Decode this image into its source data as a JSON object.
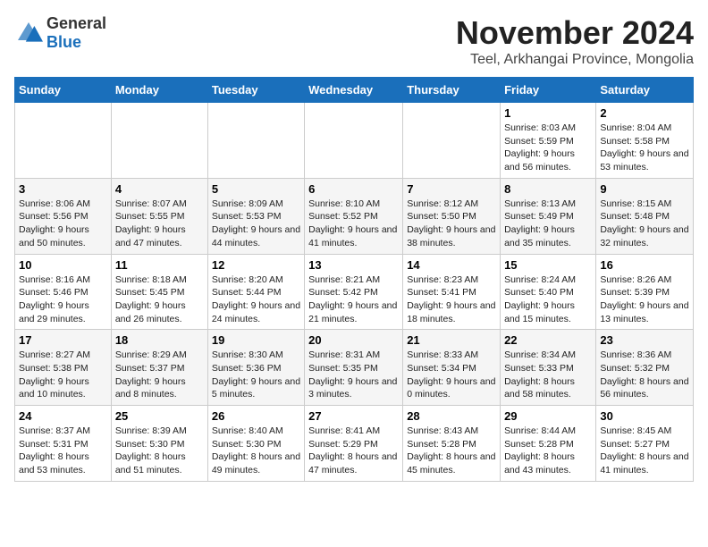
{
  "logo": {
    "general": "General",
    "blue": "Blue"
  },
  "title": {
    "month": "November 2024",
    "location": "Teel, Arkhangai Province, Mongolia"
  },
  "headers": [
    "Sunday",
    "Monday",
    "Tuesday",
    "Wednesday",
    "Thursday",
    "Friday",
    "Saturday"
  ],
  "rows": [
    [
      {
        "day": "",
        "info": ""
      },
      {
        "day": "",
        "info": ""
      },
      {
        "day": "",
        "info": ""
      },
      {
        "day": "",
        "info": ""
      },
      {
        "day": "",
        "info": ""
      },
      {
        "day": "1",
        "info": "Sunrise: 8:03 AM\nSunset: 5:59 PM\nDaylight: 9 hours and 56 minutes."
      },
      {
        "day": "2",
        "info": "Sunrise: 8:04 AM\nSunset: 5:58 PM\nDaylight: 9 hours and 53 minutes."
      }
    ],
    [
      {
        "day": "3",
        "info": "Sunrise: 8:06 AM\nSunset: 5:56 PM\nDaylight: 9 hours and 50 minutes."
      },
      {
        "day": "4",
        "info": "Sunrise: 8:07 AM\nSunset: 5:55 PM\nDaylight: 9 hours and 47 minutes."
      },
      {
        "day": "5",
        "info": "Sunrise: 8:09 AM\nSunset: 5:53 PM\nDaylight: 9 hours and 44 minutes."
      },
      {
        "day": "6",
        "info": "Sunrise: 8:10 AM\nSunset: 5:52 PM\nDaylight: 9 hours and 41 minutes."
      },
      {
        "day": "7",
        "info": "Sunrise: 8:12 AM\nSunset: 5:50 PM\nDaylight: 9 hours and 38 minutes."
      },
      {
        "day": "8",
        "info": "Sunrise: 8:13 AM\nSunset: 5:49 PM\nDaylight: 9 hours and 35 minutes."
      },
      {
        "day": "9",
        "info": "Sunrise: 8:15 AM\nSunset: 5:48 PM\nDaylight: 9 hours and 32 minutes."
      }
    ],
    [
      {
        "day": "10",
        "info": "Sunrise: 8:16 AM\nSunset: 5:46 PM\nDaylight: 9 hours and 29 minutes."
      },
      {
        "day": "11",
        "info": "Sunrise: 8:18 AM\nSunset: 5:45 PM\nDaylight: 9 hours and 26 minutes."
      },
      {
        "day": "12",
        "info": "Sunrise: 8:20 AM\nSunset: 5:44 PM\nDaylight: 9 hours and 24 minutes."
      },
      {
        "day": "13",
        "info": "Sunrise: 8:21 AM\nSunset: 5:42 PM\nDaylight: 9 hours and 21 minutes."
      },
      {
        "day": "14",
        "info": "Sunrise: 8:23 AM\nSunset: 5:41 PM\nDaylight: 9 hours and 18 minutes."
      },
      {
        "day": "15",
        "info": "Sunrise: 8:24 AM\nSunset: 5:40 PM\nDaylight: 9 hours and 15 minutes."
      },
      {
        "day": "16",
        "info": "Sunrise: 8:26 AM\nSunset: 5:39 PM\nDaylight: 9 hours and 13 minutes."
      }
    ],
    [
      {
        "day": "17",
        "info": "Sunrise: 8:27 AM\nSunset: 5:38 PM\nDaylight: 9 hours and 10 minutes."
      },
      {
        "day": "18",
        "info": "Sunrise: 8:29 AM\nSunset: 5:37 PM\nDaylight: 9 hours and 8 minutes."
      },
      {
        "day": "19",
        "info": "Sunrise: 8:30 AM\nSunset: 5:36 PM\nDaylight: 9 hours and 5 minutes."
      },
      {
        "day": "20",
        "info": "Sunrise: 8:31 AM\nSunset: 5:35 PM\nDaylight: 9 hours and 3 minutes."
      },
      {
        "day": "21",
        "info": "Sunrise: 8:33 AM\nSunset: 5:34 PM\nDaylight: 9 hours and 0 minutes."
      },
      {
        "day": "22",
        "info": "Sunrise: 8:34 AM\nSunset: 5:33 PM\nDaylight: 8 hours and 58 minutes."
      },
      {
        "day": "23",
        "info": "Sunrise: 8:36 AM\nSunset: 5:32 PM\nDaylight: 8 hours and 56 minutes."
      }
    ],
    [
      {
        "day": "24",
        "info": "Sunrise: 8:37 AM\nSunset: 5:31 PM\nDaylight: 8 hours and 53 minutes."
      },
      {
        "day": "25",
        "info": "Sunrise: 8:39 AM\nSunset: 5:30 PM\nDaylight: 8 hours and 51 minutes."
      },
      {
        "day": "26",
        "info": "Sunrise: 8:40 AM\nSunset: 5:30 PM\nDaylight: 8 hours and 49 minutes."
      },
      {
        "day": "27",
        "info": "Sunrise: 8:41 AM\nSunset: 5:29 PM\nDaylight: 8 hours and 47 minutes."
      },
      {
        "day": "28",
        "info": "Sunrise: 8:43 AM\nSunset: 5:28 PM\nDaylight: 8 hours and 45 minutes."
      },
      {
        "day": "29",
        "info": "Sunrise: 8:44 AM\nSunset: 5:28 PM\nDaylight: 8 hours and 43 minutes."
      },
      {
        "day": "30",
        "info": "Sunrise: 8:45 AM\nSunset: 5:27 PM\nDaylight: 8 hours and 41 minutes."
      }
    ]
  ]
}
